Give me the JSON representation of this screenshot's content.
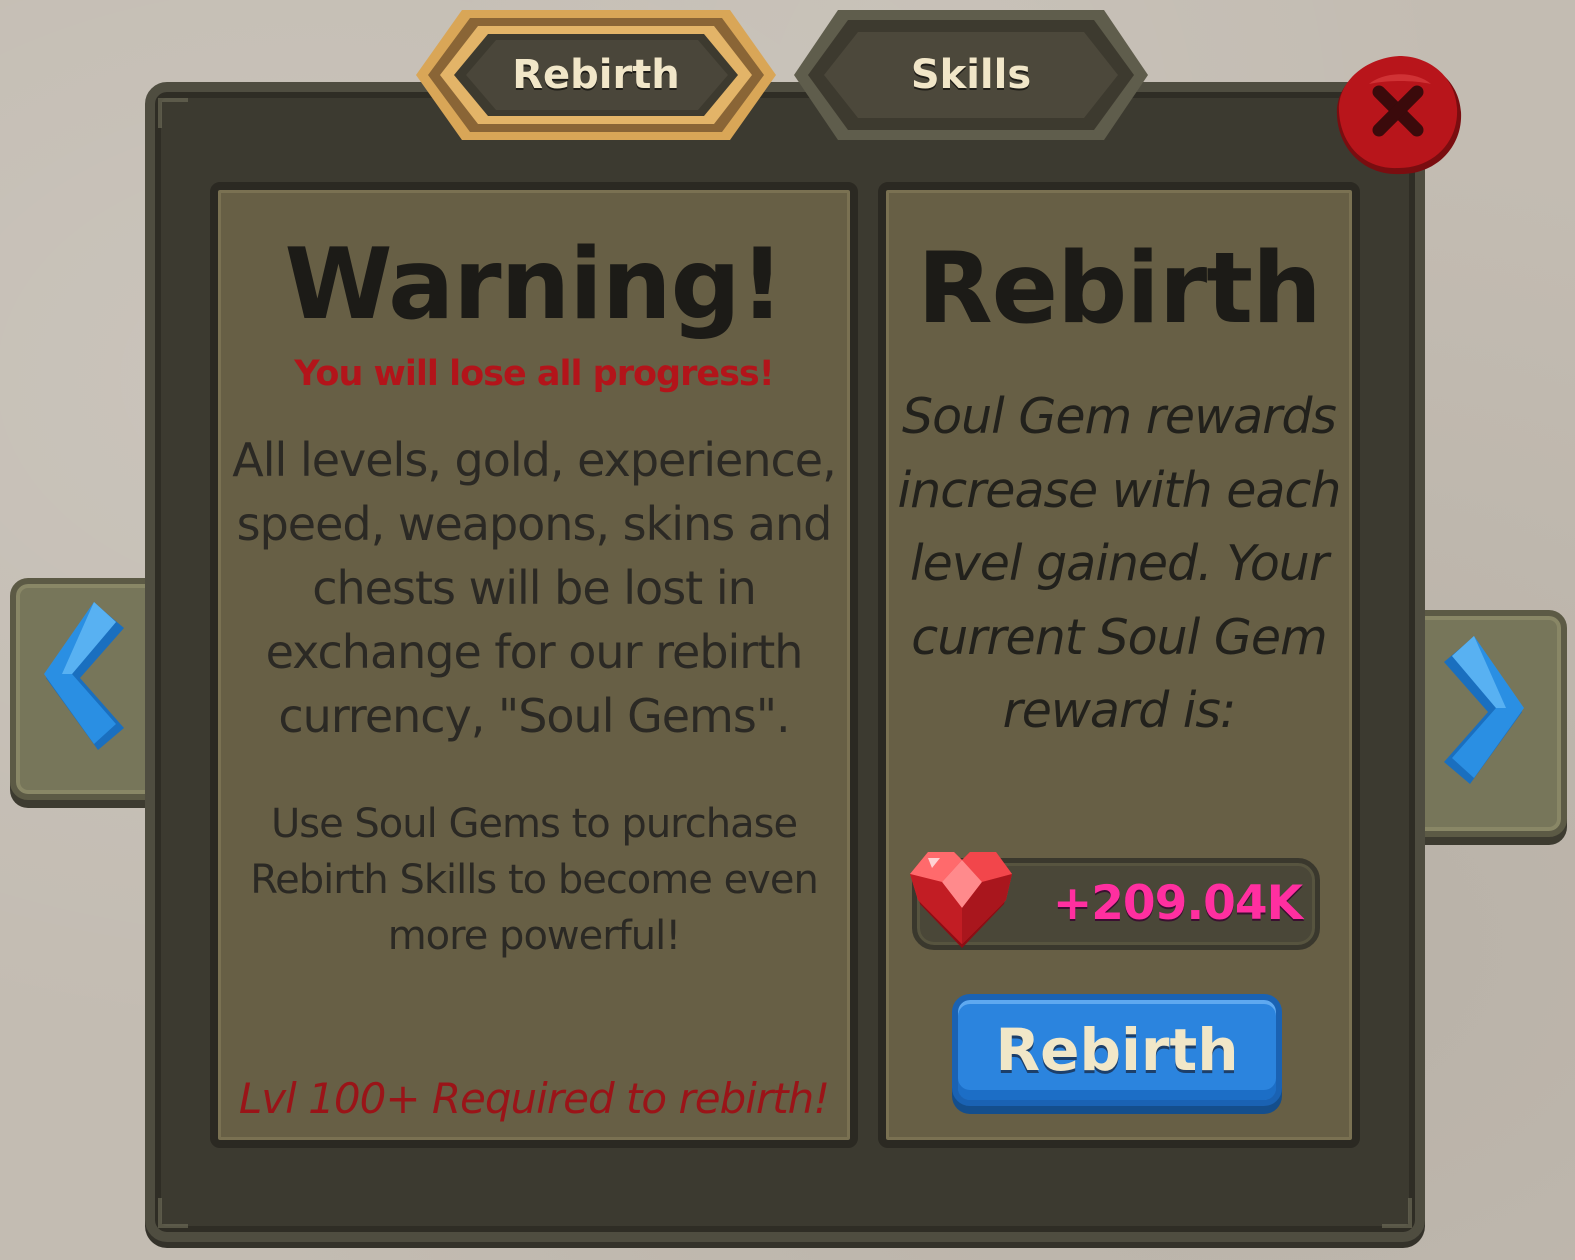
{
  "tabs": [
    {
      "label": "Rebirth",
      "active": true
    },
    {
      "label": "Skills",
      "active": false
    }
  ],
  "warning_panel": {
    "title": "Warning!",
    "subtitle": "You will lose all progress!",
    "body": "All levels, gold, experience, speed, weapons, skins and chests will be lost in exchange for our rebirth currency, \"Soul Gems\".",
    "body2": "Use Soul Gems to purchase Rebirth Skills to become even more powerful!",
    "requirement": "Lvl 100+ Required to rebirth!"
  },
  "rebirth_panel": {
    "title": "Rebirth",
    "description": "Soul Gem rewards increase with each level gained. Your current Soul Gem reward is:",
    "reward_value": "+209.04K",
    "reward_icon": "heart-gem-icon",
    "button_label": "Rebirth"
  },
  "colors": {
    "frame": "#3c3a30",
    "panel": "#675f45",
    "warning_red": "#b3141a",
    "reward_pink": "#ff2fa0",
    "button_blue": "#2b84de",
    "arrow_blue": "#1f86d8",
    "close_red": "#b8151b",
    "tab_gold": "#d9a657"
  },
  "icons": {
    "close": "close-x-icon",
    "prev": "chevron-left-icon",
    "next": "chevron-right-icon"
  }
}
